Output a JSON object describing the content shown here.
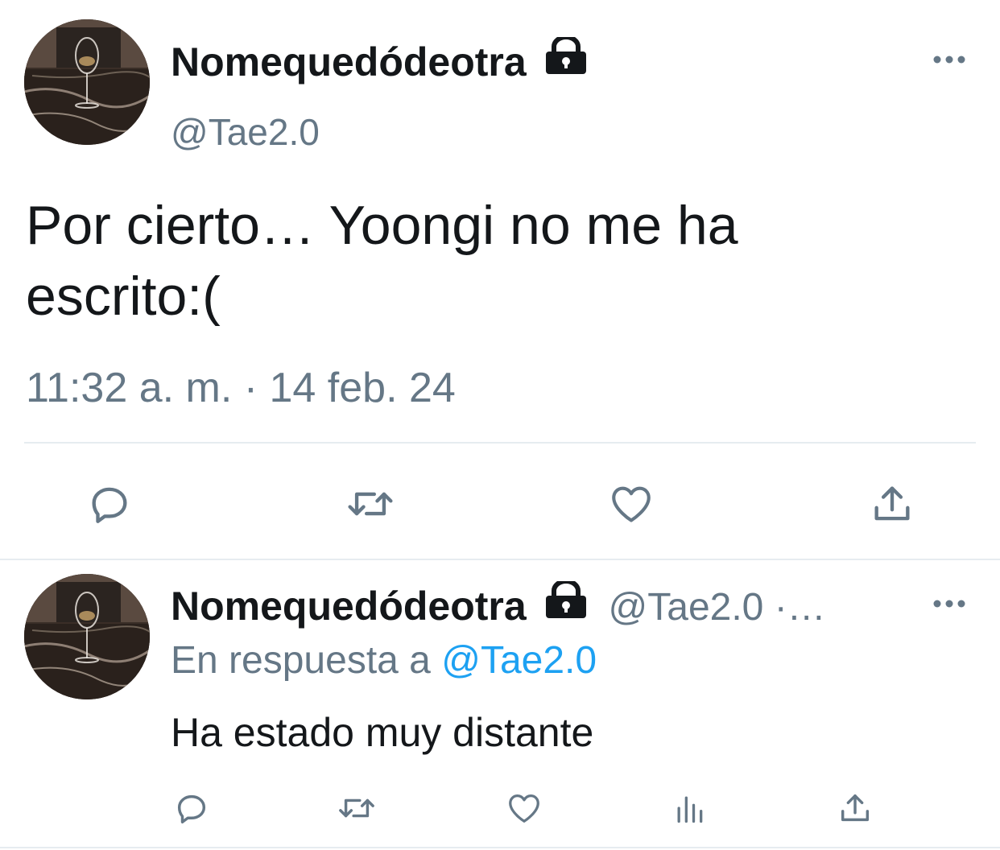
{
  "main_tweet": {
    "author_name": "Nomequedódeotra",
    "handle": "@Tae2.0",
    "text": "Por cierto… Yoongi no me ha escrito:(",
    "timestamp": "11:32 a. m. · 14 feb. 24",
    "icons": {
      "lock": "lock-icon",
      "more": "more-options-icon",
      "reply": "reply-icon",
      "retweet": "retweet-icon",
      "like": "like-icon",
      "share": "share-icon"
    }
  },
  "reply_tweet": {
    "author_name": "Nomequedódeotra",
    "handle_time": "@Tae2.0 ·…",
    "reply_prefix": "En respuesta a",
    "reply_mention": "@Tae2.0",
    "text": "Ha estado muy distante",
    "icons": {
      "lock": "lock-icon",
      "more": "more-options-icon",
      "reply": "reply-icon",
      "retweet": "retweet-icon",
      "like": "like-icon",
      "analytics": "analytics-icon",
      "share": "share-icon"
    }
  },
  "colors": {
    "text": "#14171a",
    "secondary": "#657786",
    "link": "#1da1f2",
    "divider": "#e6ecf0"
  }
}
